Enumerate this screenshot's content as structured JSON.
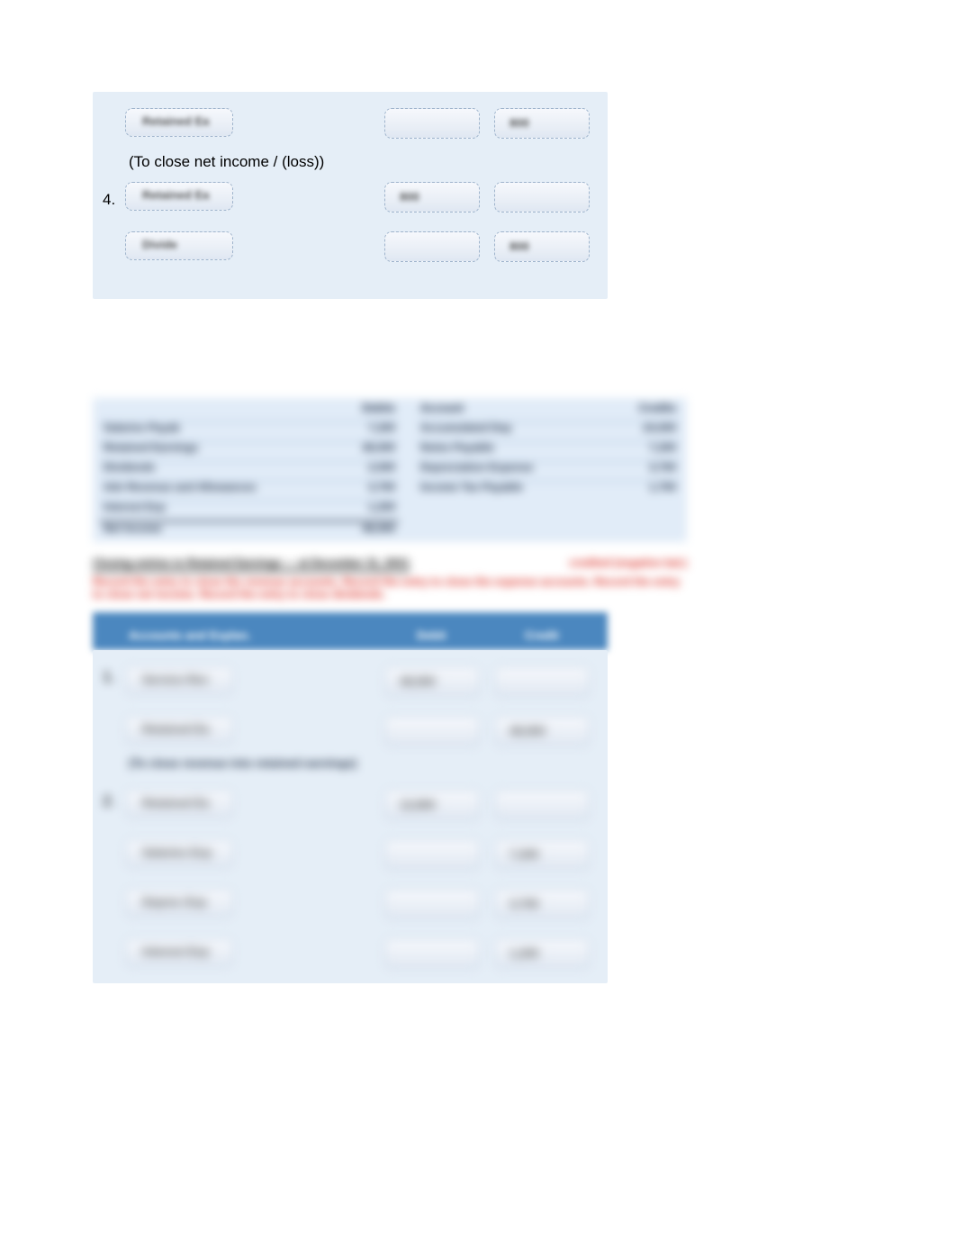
{
  "top_journal": {
    "rows": [
      {
        "num": "",
        "account": "Retained Ea",
        "debit": "",
        "credit": "800"
      },
      {
        "note": "(To close net income / (loss))"
      },
      {
        "num": "4.",
        "account": "Retained Ea",
        "debit": "800",
        "credit": ""
      },
      {
        "num": "",
        "account": "Divide",
        "debit": "",
        "credit": "800"
      }
    ]
  },
  "mid_table": {
    "left_header": "Debits",
    "right_header": "Credits",
    "left_rows": [
      {
        "label": "Salaries Payab",
        "value": "7,200"
      },
      {
        "label": "Retained Earnings",
        "value": "48,000"
      },
      {
        "label": "Dividends",
        "value": "2,000"
      },
      {
        "label": "Adv Revenue and Allowances",
        "value": "3,700"
      },
      {
        "label": "Interest Exp",
        "value": "1,200"
      },
      {
        "label": "Net Income",
        "value": "48,000"
      }
    ],
    "right_rows": [
      {
        "label": "Accumulated Dep",
        "value": "24,000"
      },
      {
        "label": "Notes Payable",
        "value": "7,200"
      },
      {
        "label": "Depreciation Expense",
        "value": "3,700"
      },
      {
        "label": "Income Tax Payable",
        "value": "1,700"
      }
    ]
  },
  "red_block": {
    "heading_black": "Closing entries to Retained Earnings — at December 31, 20X1",
    "body": "Record the entry to close the revenue accounts. Record the entry to close the expense accounts. Record the entry to close net income. Record the entry to close dividends.",
    "aside": "credited (negative bal.)"
  },
  "lower_header": {
    "col1": "Accounts and Explan.",
    "col2": "Debit",
    "col3": "Credit"
  },
  "lower_journal": {
    "rows": [
      {
        "num": "1.",
        "account": "Service Rev",
        "debit": "48,000",
        "credit": ""
      },
      {
        "num": "",
        "account": "Retained Ea",
        "debit": "",
        "credit": "48,000",
        "note": "(To close revenue into retained earnings)"
      },
      {
        "num": "2.",
        "account": "Retained Ea",
        "debit": "12,800",
        "credit": ""
      },
      {
        "num": "",
        "account": "Salaries Exp",
        "debit": "",
        "credit": "7,200"
      },
      {
        "num": "",
        "account": "Deprec Exp",
        "debit": "",
        "credit": "3,700"
      },
      {
        "num": "",
        "account": "Interest Exp",
        "debit": "",
        "credit": "1,200"
      }
    ]
  }
}
